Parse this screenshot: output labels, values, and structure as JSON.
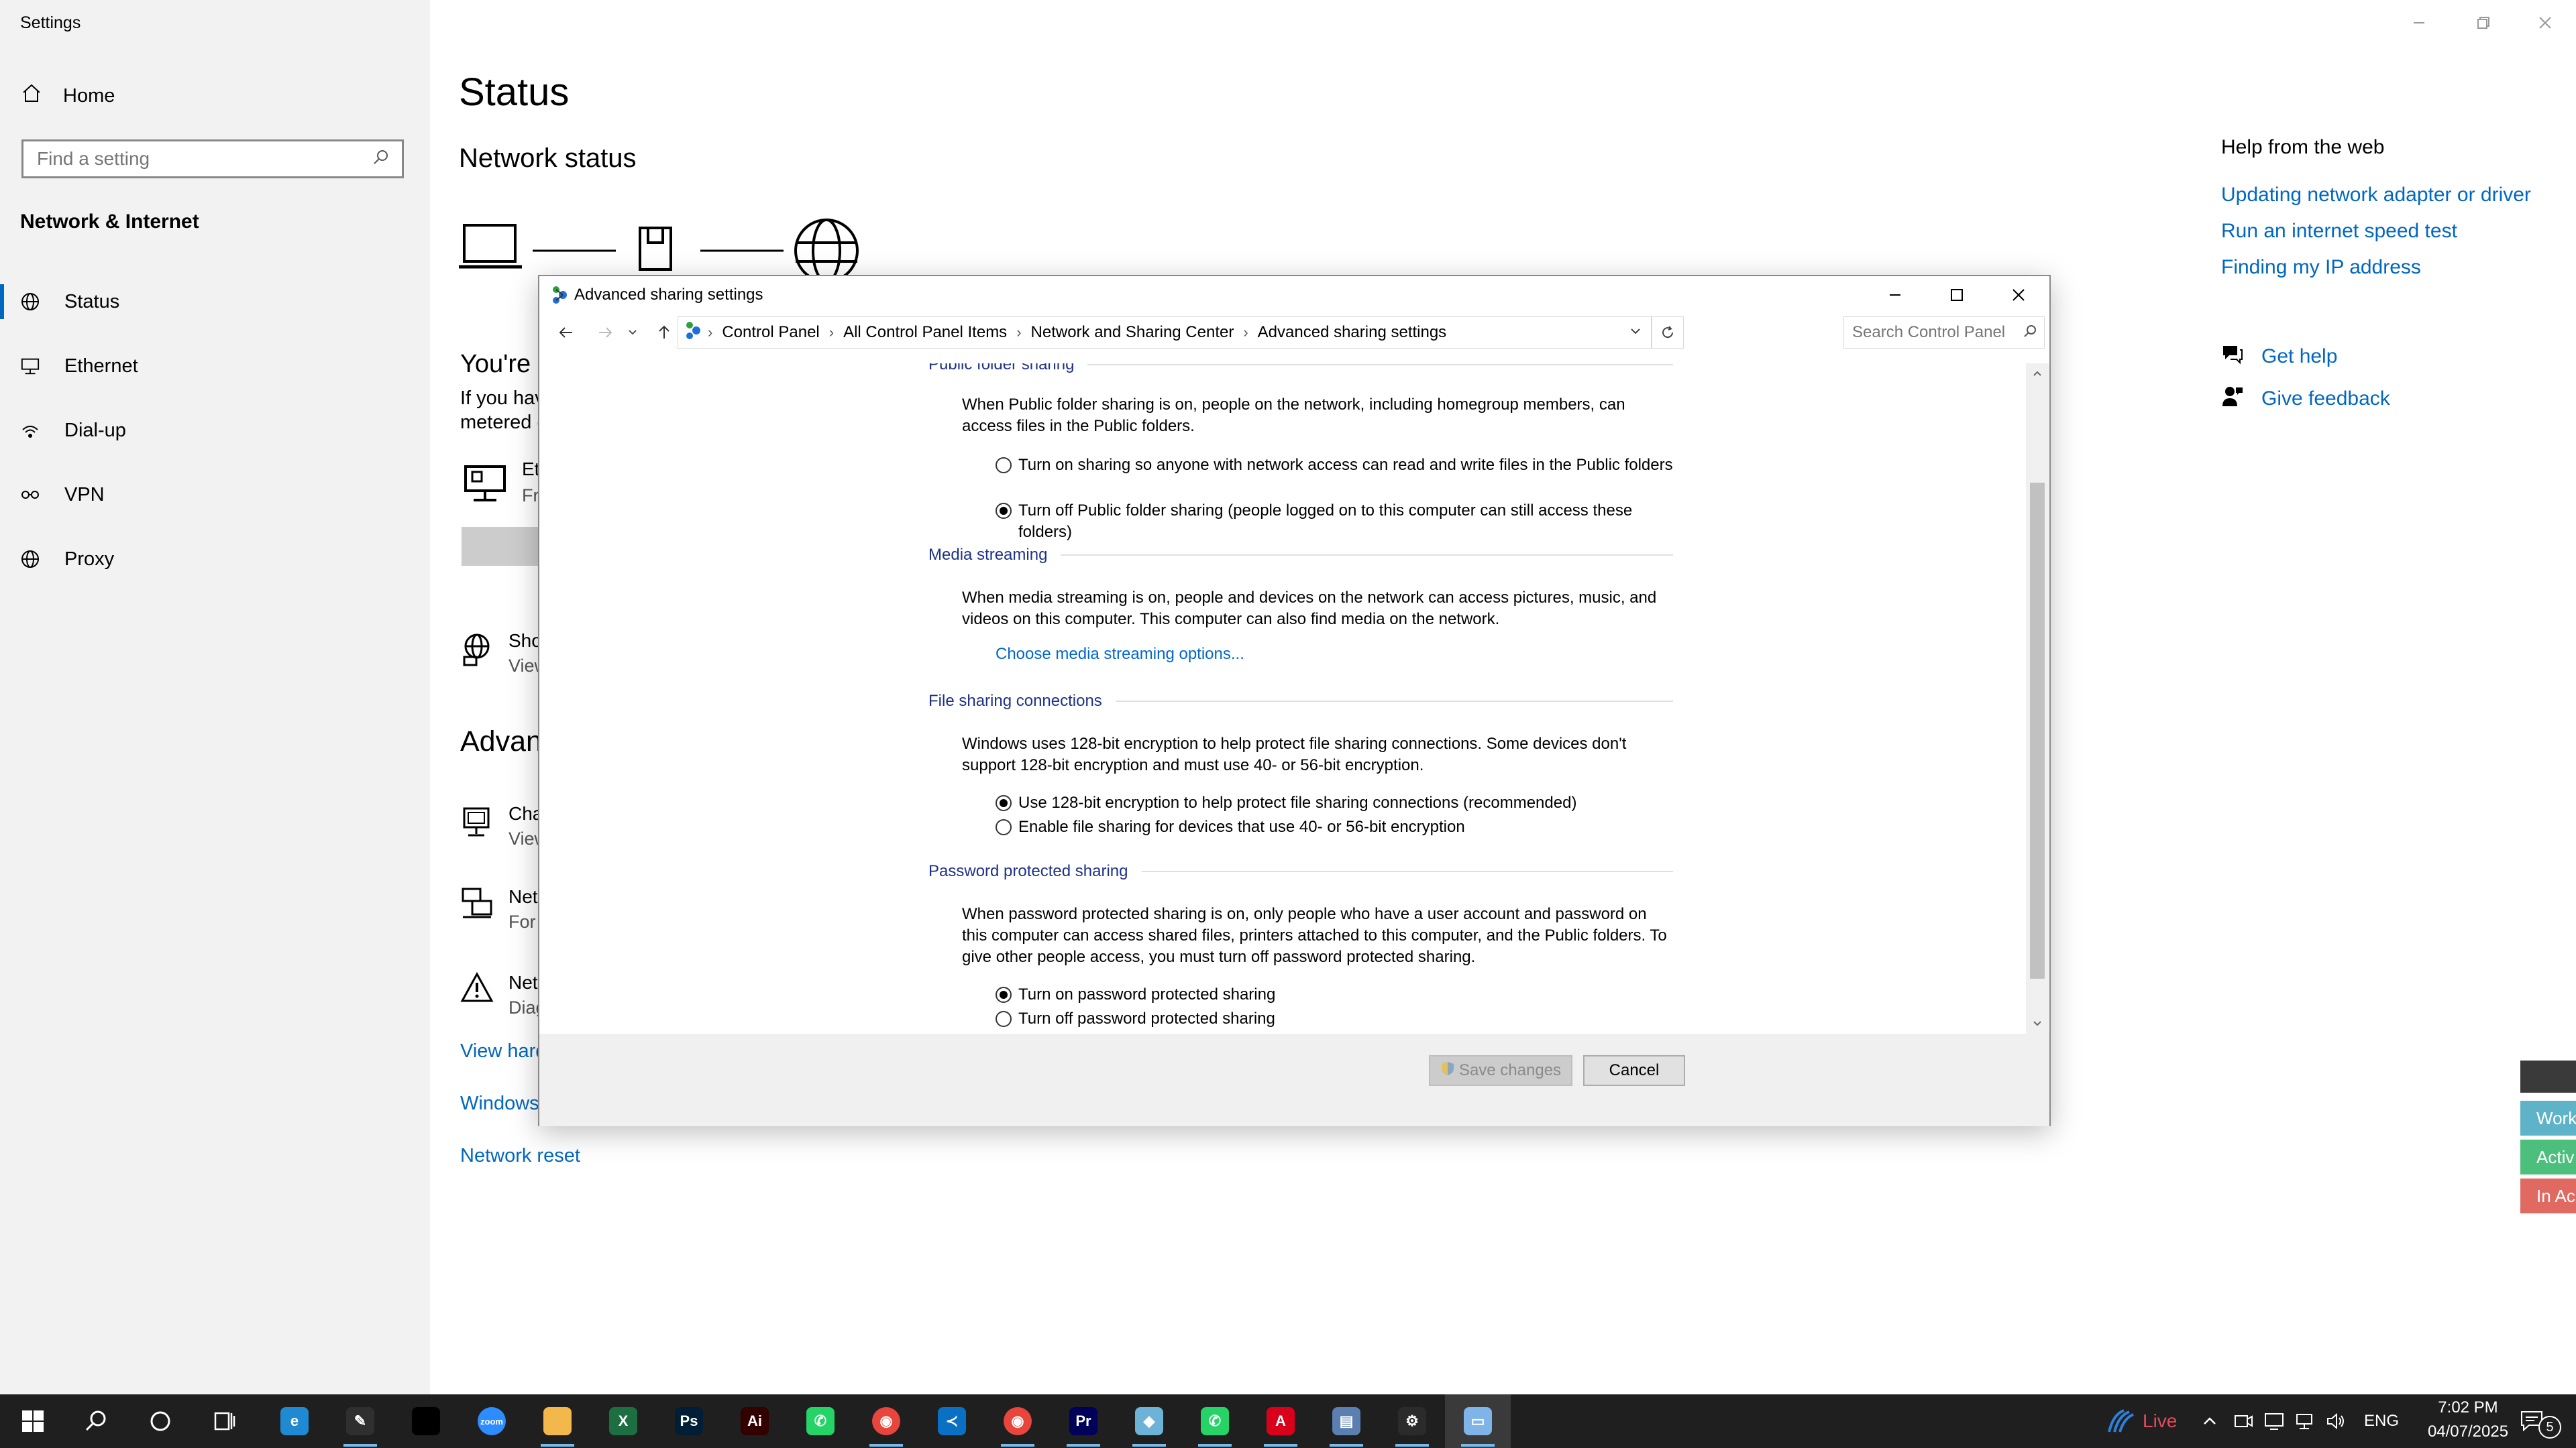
{
  "settings": {
    "app_title": "Settings",
    "sidebar": {
      "home": "Home",
      "search_placeholder": "Find a setting",
      "section": "Network & Internet",
      "items": [
        {
          "label": "Status",
          "icon": "globe-icon"
        },
        {
          "label": "Ethernet",
          "icon": "ethernet-icon"
        },
        {
          "label": "Dial-up",
          "icon": "dialup-icon"
        },
        {
          "label": "VPN",
          "icon": "vpn-icon"
        },
        {
          "label": "Proxy",
          "icon": "globe-icon"
        }
      ]
    },
    "main": {
      "title": "Status",
      "network_status": "Network status",
      "frag_youre": "You're c",
      "frag_if_you": "If you hav",
      "frag_metered": "metered c",
      "frag_et": "Et",
      "frag_fr": "Fr",
      "frag_sho": "Sho",
      "frag_view1": "View",
      "frag_advan": "Advanc",
      "frag_cha": "Cha",
      "frag_view2": "View",
      "frag_net1": "Net",
      "frag_for": "For",
      "frag_net2": "Net",
      "frag_diag": "Diag",
      "view_hard": "View hard",
      "windows": "Windows",
      "network_reset": "Network reset"
    },
    "help": {
      "title": "Help from the web",
      "links": [
        "Updating network adapter or driver",
        "Run an internet speed test",
        "Finding my IP address"
      ],
      "get_help": "Get help",
      "give_feedback": "Give feedback"
    },
    "side_tabs": [
      {
        "label": "Work",
        "color": "#5fb3c8"
      },
      {
        "label": "Activ",
        "color": "#4dbf7d"
      },
      {
        "label": "In Ac",
        "color": "#e06a62"
      }
    ]
  },
  "dialog": {
    "title": "Advanced sharing settings",
    "breadcrumb": [
      "Control Panel",
      "All Control Panel Items",
      "Network and Sharing Center",
      "Advanced sharing settings"
    ],
    "search_placeholder": "Search Control Panel",
    "sections": {
      "public_folder": {
        "heading": "Public folder sharing",
        "description": "When Public folder sharing is on, people on the network, including homegroup members, can access files in the Public folders.",
        "options": [
          {
            "label": "Turn on sharing so anyone with network access can read and write files in the Public folders",
            "checked": false
          },
          {
            "label": "Turn off Public folder sharing (people logged on to this computer can still access these folders)",
            "checked": true
          }
        ]
      },
      "media_streaming": {
        "heading": "Media streaming",
        "description": "When media streaming is on, people and devices on the network can access pictures, music, and videos on this computer. This computer can also find media on the network.",
        "link": "Choose media streaming options..."
      },
      "file_sharing": {
        "heading": "File sharing connections",
        "description": "Windows uses 128-bit encryption to help protect file sharing connections. Some devices don't support 128-bit encryption and must use 40- or 56-bit encryption.",
        "options": [
          {
            "label": "Use 128-bit encryption to help protect file sharing connections (recommended)",
            "checked": true
          },
          {
            "label": "Enable file sharing for devices that use 40- or 56-bit encryption",
            "checked": false
          }
        ]
      },
      "password": {
        "heading": "Password protected sharing",
        "description": "When password protected sharing is on, only people who have a user account and password on this computer can access shared files, printers attached to this computer, and the Public folders. To give other people access, you must turn off password protected sharing.",
        "options": [
          {
            "label": "Turn on password protected sharing",
            "checked": true
          },
          {
            "label": "Turn off password protected sharing",
            "checked": false
          }
        ]
      }
    },
    "buttons": {
      "save": "Save changes",
      "cancel": "Cancel"
    }
  },
  "taskbar": {
    "live": "Live",
    "lang": "ENG",
    "time": "7:02 PM",
    "date": "04/07/2025",
    "notifications": "5",
    "apps": [
      {
        "name": "edge",
        "color": "#1f8ad2",
        "glyph": "e"
      },
      {
        "name": "pen",
        "color": "#2f2f2f",
        "glyph": "✎"
      },
      {
        "name": "terminal",
        "color": "#000000",
        "glyph": ""
      },
      {
        "name": "zoom",
        "color": "#2d8cff",
        "glyph": "zoom"
      },
      {
        "name": "explorer",
        "color": "#f2b84b",
        "glyph": ""
      },
      {
        "name": "excel",
        "color": "#1d6f42",
        "glyph": "X"
      },
      {
        "name": "photoshop",
        "color": "#001e36",
        "glyph": "Ps"
      },
      {
        "name": "illustrator",
        "color": "#330000",
        "glyph": "Ai"
      },
      {
        "name": "whatsapp-green",
        "color": "#25d366",
        "glyph": "✆"
      },
      {
        "name": "chrome",
        "color": "#e8453c",
        "glyph": "◉"
      },
      {
        "name": "vscode",
        "color": "#0a70c4",
        "glyph": "≺"
      },
      {
        "name": "chrome-2",
        "color": "#e8453c",
        "glyph": "◉"
      },
      {
        "name": "premiere",
        "color": "#00005b",
        "glyph": "Pr"
      },
      {
        "name": "network-app",
        "color": "#6db3d8",
        "glyph": "◆"
      },
      {
        "name": "whatsapp-green-2",
        "color": "#25d366",
        "glyph": "✆"
      },
      {
        "name": "acrobat",
        "color": "#d9001b",
        "glyph": "A"
      },
      {
        "name": "dialog-app",
        "color": "#5a7fb0",
        "glyph": "▤"
      },
      {
        "name": "settings",
        "color": "#2b2b2b",
        "glyph": "⚙"
      },
      {
        "name": "control-panel",
        "color": "#7fb4e8",
        "glyph": "▭"
      }
    ]
  }
}
